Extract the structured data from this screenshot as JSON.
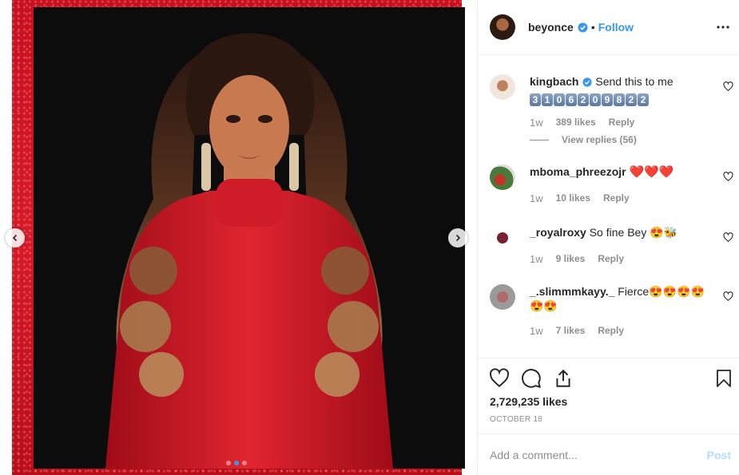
{
  "post": {
    "username": "beyonce",
    "separator": "•",
    "follow_label": "Follow",
    "image_alt": "Woman in red sparkly turtleneck dress with long curly hair",
    "carousel_dots": 3,
    "active_dot": 1
  },
  "comments": [
    {
      "username": "kingbach",
      "verified": true,
      "text": "Send this to me",
      "keycaps": [
        "3",
        "1",
        "0",
        "6",
        "2",
        "0",
        "9",
        "8",
        "2",
        "2"
      ],
      "time": "1w",
      "likes": "389 likes",
      "reply": "Reply",
      "view_replies": "View replies (56)"
    },
    {
      "username": "mboma_phreezojr",
      "text": "❤️❤️❤️",
      "time": "1w",
      "likes": "10 likes",
      "reply": "Reply"
    },
    {
      "username": "_royalroxy",
      "text": "So fine Bey 😍🐝",
      "time": "1w",
      "likes": "9 likes",
      "reply": "Reply"
    },
    {
      "username": "_.slimmmkayy._",
      "text": "Fierce😍😍😍😍😍😍",
      "time": "1w",
      "likes": "7 likes",
      "reply": "Reply"
    }
  ],
  "actions": {
    "likes_count": "2,729,235 likes",
    "date": "OCTOBER 18"
  },
  "add_comment": {
    "placeholder": "Add a comment...",
    "post_label": "Post"
  },
  "colors": {
    "accent": "#3897f0",
    "frame_red": "#d71a28",
    "muted": "#8e8e8e",
    "post_disabled": "#b3dbff"
  }
}
